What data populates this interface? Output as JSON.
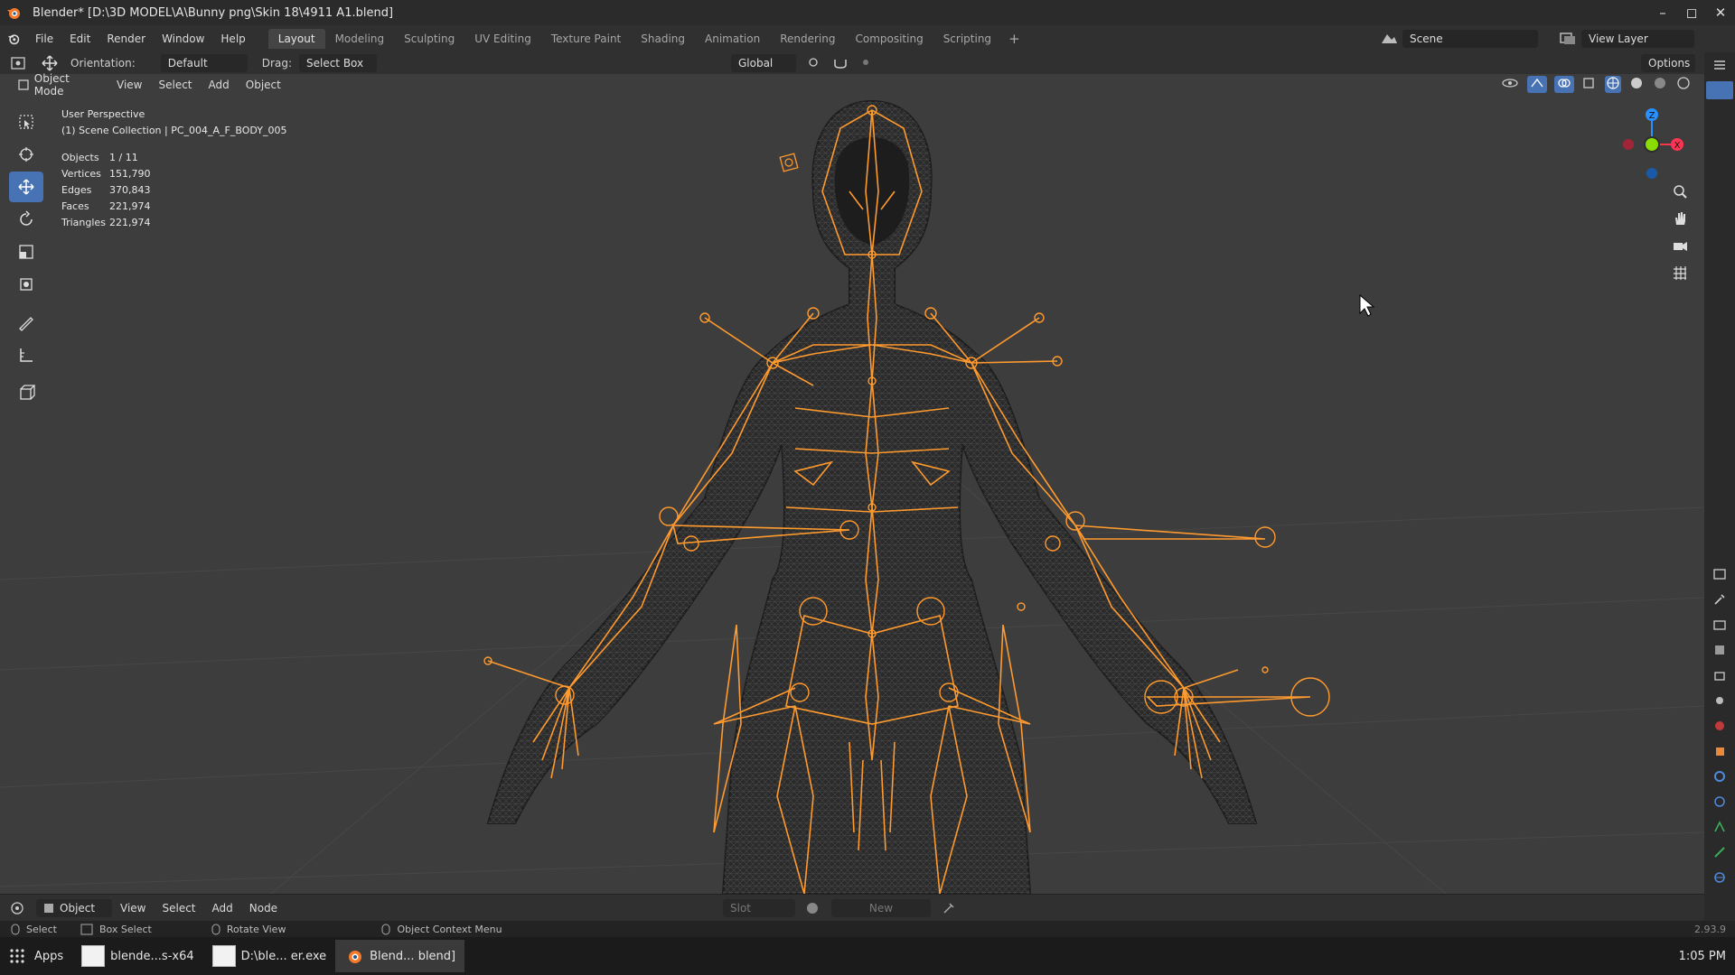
{
  "titlebar": {
    "title": "Blender* [D:\\3D MODEL\\A\\Bunny png\\Skin 18\\4911 A1.blend]",
    "minimize": "–",
    "maximize": "◻",
    "close": "✕"
  },
  "menu": {
    "items": [
      "File",
      "Edit",
      "Render",
      "Window",
      "Help"
    ]
  },
  "workspaces": {
    "tabs": [
      "Layout",
      "Modeling",
      "Sculpting",
      "UV Editing",
      "Texture Paint",
      "Shading",
      "Animation",
      "Rendering",
      "Compositing",
      "Scripting"
    ],
    "active": "Layout",
    "add": "+"
  },
  "scene": {
    "name": "Scene",
    "view_layer": "View Layer"
  },
  "toolheader": {
    "orientation_label": "Orientation:",
    "orientation_value": "Default",
    "drag_label": "Drag:",
    "drag_value": "Select Box",
    "transform_orientation": "Global",
    "options": "Options"
  },
  "viewport_header": {
    "mode": "Object Mode",
    "menus": [
      "View",
      "Select",
      "Add",
      "Object"
    ]
  },
  "overlay": {
    "view_name": "User Perspective",
    "collection": "(1) Scene Collection | PC_004_A_F_BODY_005",
    "stats": [
      {
        "label": "Objects",
        "value": "1 / 11"
      },
      {
        "label": "Vertices",
        "value": "151,790"
      },
      {
        "label": "Edges",
        "value": "370,843"
      },
      {
        "label": "Faces",
        "value": "221,974"
      },
      {
        "label": "Triangles",
        "value": "221,974"
      }
    ]
  },
  "gizmo": {
    "z": "Z",
    "x": "X"
  },
  "editor_header": {
    "type": "Object",
    "menus": [
      "View",
      "Select",
      "Add",
      "Node"
    ],
    "slot": "Slot",
    "new_label": "New"
  },
  "statusbar": {
    "items": [
      "Select",
      "Box Select",
      "Rotate View",
      "Object Context Menu"
    ],
    "version": "2.93.9"
  },
  "taskbar": {
    "apps_label": "Apps",
    "items": [
      "blende...s-x64",
      "D:\\ble... er.exe",
      "Blend... blend]"
    ],
    "clock": "1:05 PM"
  },
  "colors": {
    "accent": "#4772b3",
    "armature": "#ff9a2e",
    "viewport_bg": "#3d3d3d",
    "axis_x": "#ff3352",
    "axis_y": "#8bdc00",
    "axis_z": "#2890ff"
  },
  "icons": [
    "blender-logo-icon",
    "select-box-icon",
    "cursor-icon",
    "move-icon",
    "rotate-icon",
    "scale-icon",
    "transform-icon",
    "annotate-icon",
    "measure-icon",
    "add-cube-icon",
    "zoom-icon",
    "hand-icon",
    "camera-icon",
    "grid-icon"
  ]
}
